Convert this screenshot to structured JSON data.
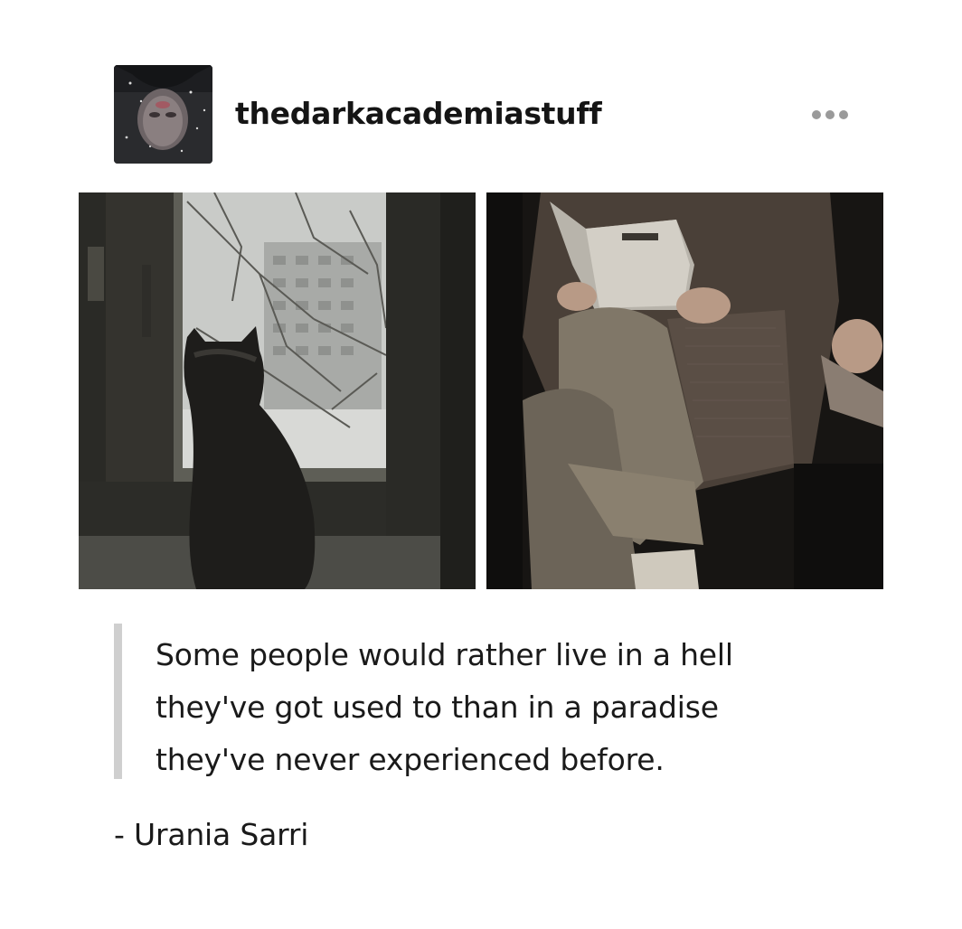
{
  "post": {
    "author": {
      "username": "thedarkacademiastuff",
      "avatar_icon": "avatar-portrait"
    },
    "more_icon": "ellipsis-icon",
    "photos": [
      {
        "subject": "cat-at-window-photo"
      },
      {
        "subject": "person-reading-book-photo"
      }
    ],
    "quote": {
      "lines": [
        "Some people would rather live in a hell",
        "they've got used to than in a paradise",
        "they've never experienced before."
      ]
    },
    "attribution": "- Urania Sarri"
  },
  "colors": {
    "background": "#ffffff",
    "text": "#1a1a1a",
    "quote_bar": "#cfcfcf",
    "more_dots": "#9a9a9a"
  }
}
